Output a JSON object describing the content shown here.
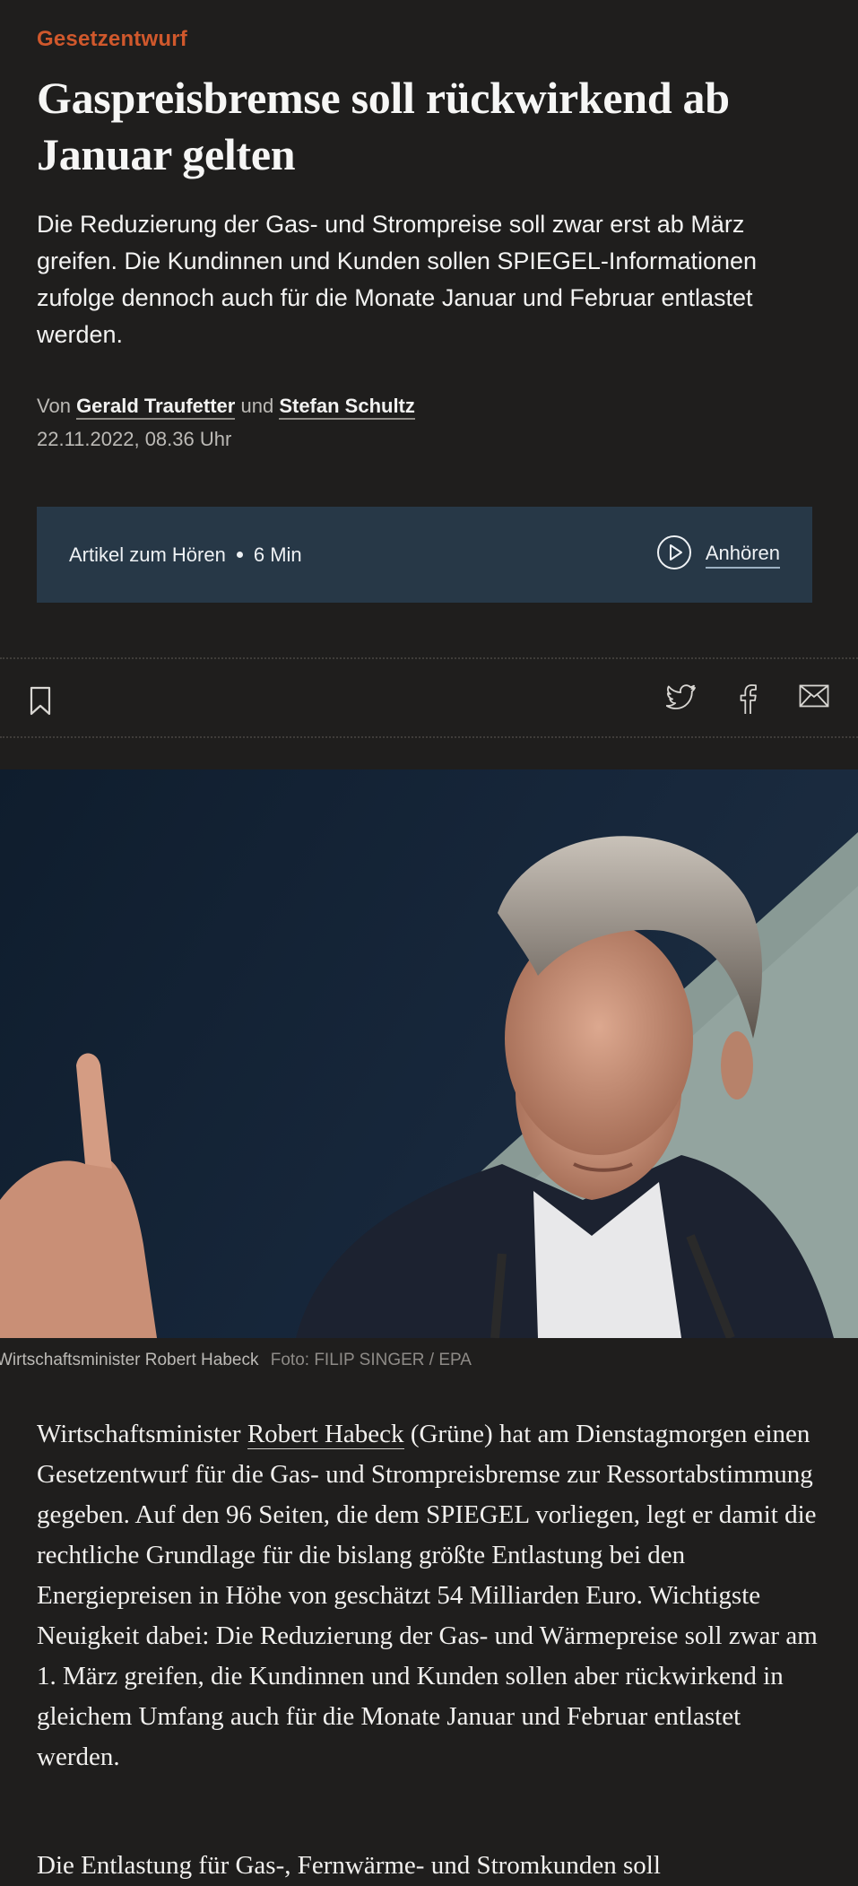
{
  "article": {
    "kicker": "Gesetzentwurf",
    "headline": "Gaspreisbremse soll rückwirkend ab Januar gelten",
    "teaser": "Die Reduzierung der Gas- und Strompreise soll zwar erst ab März greifen. Die Kundinnen und Kunden sollen SPIEGEL-Informationen zufolge dennoch auch für die Monate Januar und Februar entlastet werden.",
    "byline": {
      "prefix": "Von",
      "author1": "Gerald Traufetter",
      "joiner": "und",
      "author2": "Stefan Schultz"
    },
    "date": "22.11.2022, 08.36 Uhr"
  },
  "audio": {
    "label": "Artikel zum Hören",
    "duration": "6 Min",
    "button": "Anhören"
  },
  "share": {
    "icons": [
      "bookmark-icon",
      "twitter-icon",
      "facebook-icon",
      "mail-icon"
    ]
  },
  "photo": {
    "caption": "Wirtschaftsminister Robert Habeck",
    "credit": "Foto: FILIP SINGER / EPA"
  },
  "body": {
    "p1_before": "Wirtschaftsminister ",
    "p1_link": "Robert Habeck",
    "p1_after": " (Grüne) hat am Dienstagmorgen einen Gesetzentwurf für die Gas- und Strompreisbremse zur Ressortabstimmung gegeben. Auf den 96 Seiten, die dem SPIEGEL vorliegen, legt er damit die rechtliche Grundlage für die bislang größte Entlastung bei den Energiepreisen in Höhe von geschätzt 54 Milliarden Euro. Wichtigste Neuigkeit dabei: Die Reduzierung der Gas- und Wärmepreise soll zwar am 1. März greifen, die Kundinnen und Kunden sollen aber rückwirkend in gleichem Umfang auch für die Monate Januar und Februar entlastet werden.",
    "p2_start": "Die Entlastung für Gas-, Fernwärme- und Stromkunden soll"
  },
  "colors": {
    "background": "#1f1e1d",
    "kicker": "#d0582c",
    "audio_bg": "#273847"
  }
}
